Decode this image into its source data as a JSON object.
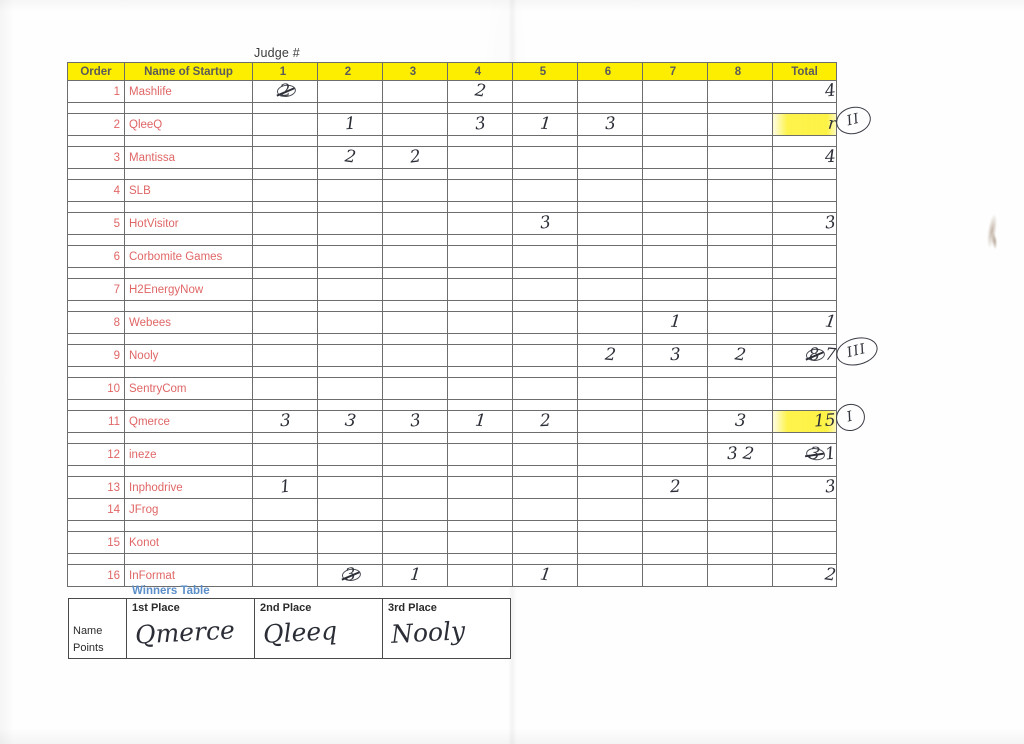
{
  "sheet": {
    "judge_caption": "Judge #"
  },
  "table": {
    "headers": {
      "order": "Order",
      "name": "Name of Startup",
      "judges": [
        "1",
        "2",
        "3",
        "4",
        "5",
        "6",
        "7",
        "8"
      ],
      "total": "Total"
    },
    "rows": [
      {
        "order": "1",
        "name": "Mashlife",
        "scores": [
          "2",
          "",
          "",
          "2",
          "",
          "",
          "",
          ""
        ],
        "score_struck": [
          true,
          false,
          false,
          false,
          false,
          false,
          false,
          false
        ],
        "total": "4",
        "total_highlight": false,
        "rank_mark": ""
      },
      {
        "order": "2",
        "name": "QleeQ",
        "scores": [
          "",
          "1",
          "",
          "3",
          "1",
          "3",
          "",
          ""
        ],
        "score_struck": [
          false,
          false,
          false,
          false,
          false,
          false,
          false,
          false
        ],
        "total": "r",
        "total_highlight": true,
        "rank_mark": "II"
      },
      {
        "order": "3",
        "name": "Mantissa",
        "scores": [
          "",
          "2",
          "2",
          "",
          "",
          "",
          "",
          ""
        ],
        "score_struck": [
          false,
          false,
          false,
          false,
          false,
          false,
          false,
          false
        ],
        "total": "4",
        "total_highlight": false,
        "rank_mark": ""
      },
      {
        "order": "4",
        "name": "SLB",
        "scores": [
          "",
          "",
          "",
          "",
          "",
          "",
          "",
          ""
        ],
        "score_struck": [
          false,
          false,
          false,
          false,
          false,
          false,
          false,
          false
        ],
        "total": "",
        "total_highlight": false,
        "rank_mark": ""
      },
      {
        "order": "5",
        "name": "HotVisitor",
        "scores": [
          "",
          "",
          "",
          "",
          "3",
          "",
          "",
          ""
        ],
        "score_struck": [
          false,
          false,
          false,
          false,
          false,
          false,
          false,
          false
        ],
        "total": "3",
        "total_highlight": false,
        "rank_mark": ""
      },
      {
        "order": "6",
        "name": "Corbomite Games",
        "scores": [
          "",
          "",
          "",
          "",
          "",
          "",
          "",
          ""
        ],
        "score_struck": [
          false,
          false,
          false,
          false,
          false,
          false,
          false,
          false
        ],
        "total": "",
        "total_highlight": false,
        "rank_mark": ""
      },
      {
        "order": "7",
        "name": "H2EnergyNow",
        "scores": [
          "",
          "",
          "",
          "",
          "",
          "",
          "",
          ""
        ],
        "score_struck": [
          false,
          false,
          false,
          false,
          false,
          false,
          false,
          false
        ],
        "total": "",
        "total_highlight": false,
        "rank_mark": ""
      },
      {
        "order": "8",
        "name": "Webees",
        "scores": [
          "",
          "",
          "",
          "",
          "",
          "",
          "1",
          ""
        ],
        "score_struck": [
          false,
          false,
          false,
          false,
          false,
          false,
          false,
          false
        ],
        "total": "1",
        "total_highlight": false,
        "rank_mark": ""
      },
      {
        "order": "9",
        "name": "Nooly",
        "scores": [
          "",
          "",
          "",
          "",
          "",
          "2",
          "3",
          "2"
        ],
        "score_struck": [
          false,
          false,
          false,
          false,
          false,
          false,
          false,
          false
        ],
        "total": "8 7",
        "total_highlight": false,
        "rank_mark": "III"
      },
      {
        "order": "10",
        "name": "SentryCom",
        "scores": [
          "",
          "",
          "",
          "",
          "",
          "",
          "",
          ""
        ],
        "score_struck": [
          false,
          false,
          false,
          false,
          false,
          false,
          false,
          false
        ],
        "total": "",
        "total_highlight": false,
        "rank_mark": ""
      },
      {
        "order": "11",
        "name": "Qmerce",
        "scores": [
          "3",
          "3",
          "3",
          "1",
          "2",
          "",
          "",
          "3"
        ],
        "score_struck": [
          false,
          false,
          false,
          false,
          false,
          false,
          false,
          false
        ],
        "total": "15",
        "total_highlight": true,
        "rank_mark": "I"
      },
      {
        "order": "12",
        "name": "ineze",
        "scores": [
          "",
          "",
          "",
          "",
          "",
          "",
          "",
          "3 2"
        ],
        "score_struck": [
          false,
          false,
          false,
          false,
          false,
          false,
          false,
          false
        ],
        "total": "3 1",
        "total_highlight": false,
        "rank_mark": ""
      },
      {
        "order": "13",
        "name": "Inphodrive",
        "scores": [
          "1",
          "",
          "",
          "",
          "",
          "",
          "2",
          ""
        ],
        "score_struck": [
          false,
          false,
          false,
          false,
          false,
          false,
          false,
          false
        ],
        "total": "3",
        "total_highlight": false,
        "rank_mark": ""
      },
      {
        "order": "14",
        "name": "JFrog",
        "scores": [
          "",
          "",
          "",
          "",
          "",
          "",
          "",
          ""
        ],
        "score_struck": [
          false,
          false,
          false,
          false,
          false,
          false,
          false,
          false
        ],
        "total": "",
        "total_highlight": false,
        "rank_mark": ""
      },
      {
        "order": "15",
        "name": "Konot",
        "scores": [
          "",
          "",
          "",
          "",
          "",
          "",
          "",
          ""
        ],
        "score_struck": [
          false,
          false,
          false,
          false,
          false,
          false,
          false,
          false
        ],
        "total": "",
        "total_highlight": false,
        "rank_mark": ""
      },
      {
        "order": "16",
        "name": "InFormat",
        "scores": [
          "",
          "3",
          "1",
          "",
          "1",
          "",
          "",
          ""
        ],
        "score_struck": [
          false,
          true,
          false,
          false,
          false,
          false,
          false,
          false
        ],
        "total": "2",
        "total_highlight": false,
        "rank_mark": ""
      }
    ]
  },
  "winners": {
    "label": "Winners Table",
    "row_labels": [
      "Name",
      "Points"
    ],
    "places": [
      {
        "heading": "1st Place",
        "name": "Qmerce"
      },
      {
        "heading": "2nd Place",
        "name": "Qleeq"
      },
      {
        "heading": "3rd  Place",
        "name": "Nooly"
      }
    ]
  },
  "colors": {
    "header_yellow": "#fdee00",
    "row_text_red": "#e06666",
    "winners_blue": "#5b8fc9",
    "ink": "#2c2f38"
  }
}
